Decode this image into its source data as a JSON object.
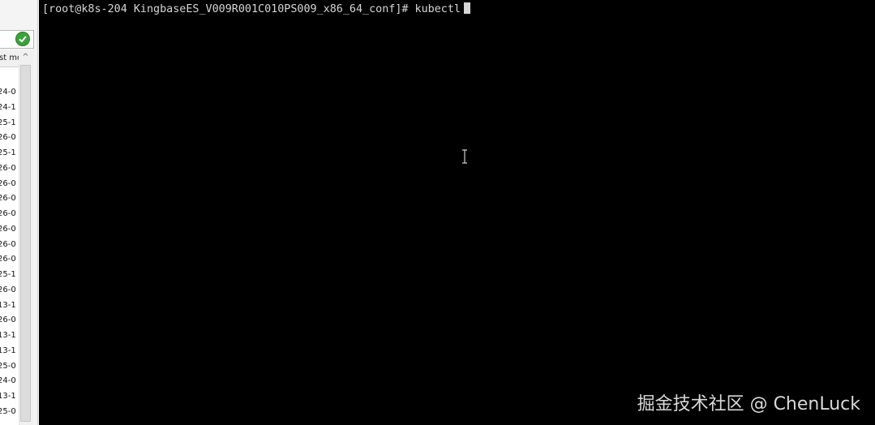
{
  "left_panel": {
    "column_header": "st mo",
    "rows": [
      "24-0",
      "24-1",
      "25-1",
      "26-0",
      "25-1",
      "26-0",
      "26-0",
      "26-0",
      "26-0",
      "26-0",
      "26-0",
      "26-0",
      "25-1",
      "26-0",
      "13-1",
      "26-0",
      "13-1",
      "13-1",
      "25-0",
      "24-0",
      "13-1",
      "25-0"
    ],
    "scroll_up_glyph": "^"
  },
  "terminal": {
    "prompt": "[root@k8s-204 KingbaseES_V009R001C010PS009_x86_64_conf]#",
    "command": "kubectl"
  },
  "watermark": {
    "text": "掘金技术社区 @ ChenLuck"
  },
  "colors": {
    "terminal_bg": "#000000",
    "terminal_fg": "#d6d6d6",
    "ok_icon": "#3aa33a"
  },
  "icons": {
    "path_status": "check-circle-icon",
    "mouse_pointer": "text-ibeam-cursor-icon"
  }
}
